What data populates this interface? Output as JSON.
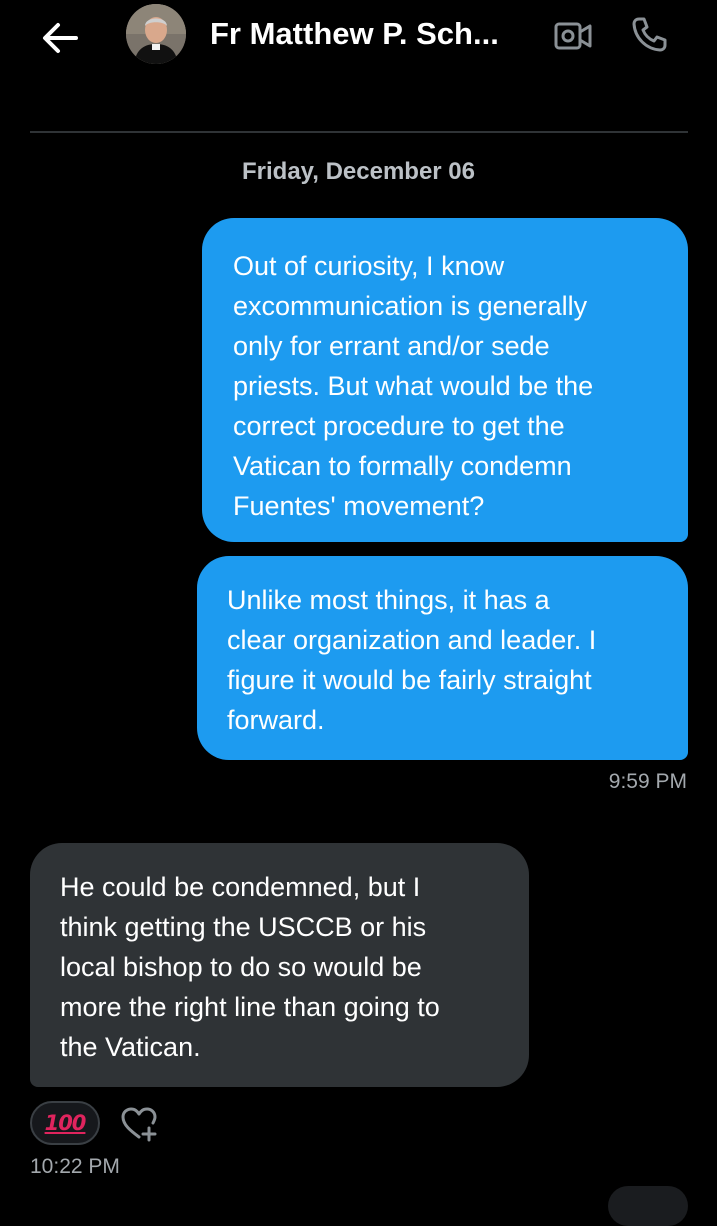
{
  "header": {
    "contact_name": "Fr Matthew P. Sch...",
    "back_icon": "arrow-left-icon",
    "video_icon": "video-call-icon",
    "call_icon": "phone-icon"
  },
  "conversation": {
    "date_separator": "Friday, December 06",
    "messages": [
      {
        "direction": "outgoing",
        "lines": [
          "Out of curiosity, I know",
          "excommunication is generally",
          "only for errant and/or sede",
          "priests. But what would be the",
          "correct procedure to get the",
          "Vatican to formally condemn",
          "Fuentes' movement?"
        ]
      },
      {
        "direction": "outgoing",
        "lines": [
          "Unlike most things, it has a",
          "clear organization and leader. I",
          "figure it would be fairly straight",
          "forward."
        ],
        "time": "9:59 PM"
      },
      {
        "direction": "incoming",
        "lines": [
          "He could be condemned, but I",
          "think getting the USCCB or his",
          "local bishop to do so would be",
          "more the right line than going to",
          "the Vatican."
        ],
        "reaction": "100",
        "time": "10:22 PM"
      }
    ]
  },
  "colors": {
    "background": "#000000",
    "outgoing_bubble": "#1d9bf0",
    "incoming_bubble": "#2f3336",
    "reaction_accent": "#e0245e"
  }
}
